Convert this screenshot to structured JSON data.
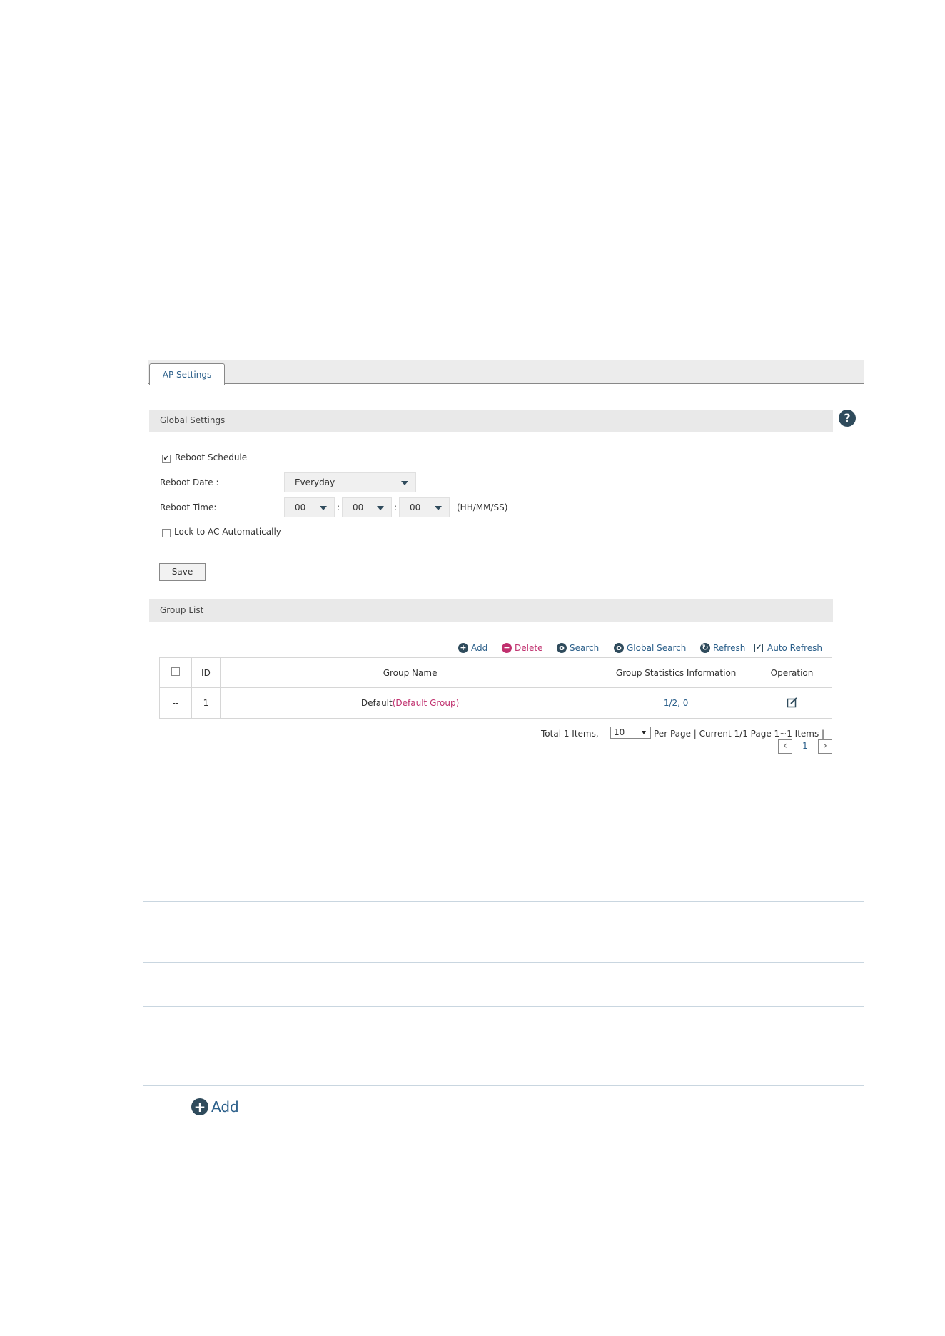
{
  "tabs": [
    {
      "label": "AP Settings"
    }
  ],
  "global_settings": {
    "title": "Global Settings",
    "reboot_schedule_label": "Reboot Schedule",
    "reboot_schedule_checked": true,
    "reboot_date_label": "Reboot Date :",
    "reboot_date_value": "Everyday",
    "reboot_time_label": "Reboot Time:",
    "reboot_time": {
      "hh": "00",
      "mm": "00",
      "ss": "00",
      "sep": ":",
      "format": "(HH/MM/SS)"
    },
    "lock_label": "Lock to AC Automatically",
    "lock_checked": false,
    "save_label": "Save",
    "help": "?"
  },
  "group_list": {
    "title": "Group List",
    "toolbar": {
      "add": "Add",
      "delete": "Delete",
      "search": "Search",
      "global_search": "Global Search",
      "refresh": "Refresh",
      "auto_refresh": "Auto Refresh",
      "auto_refresh_checked": true
    },
    "columns": [
      "ID",
      "Group Name",
      "Group Statistics Information",
      "Operation"
    ],
    "rows": [
      {
        "select": "--",
        "id": "1",
        "name": "Default",
        "name_suffix": "(Default Group)",
        "stats": "1/2, 0"
      }
    ],
    "pager": {
      "total": "Total 1 Items,",
      "page_size": "10",
      "info": "Per Page | Current 1/1 Page 1~1 Items |",
      "page": "1"
    }
  },
  "add_button": {
    "label": "Add"
  },
  "colors": {
    "accent": "#c0306e",
    "icon": "#2f4b5c",
    "link": "#2b5f8a"
  }
}
